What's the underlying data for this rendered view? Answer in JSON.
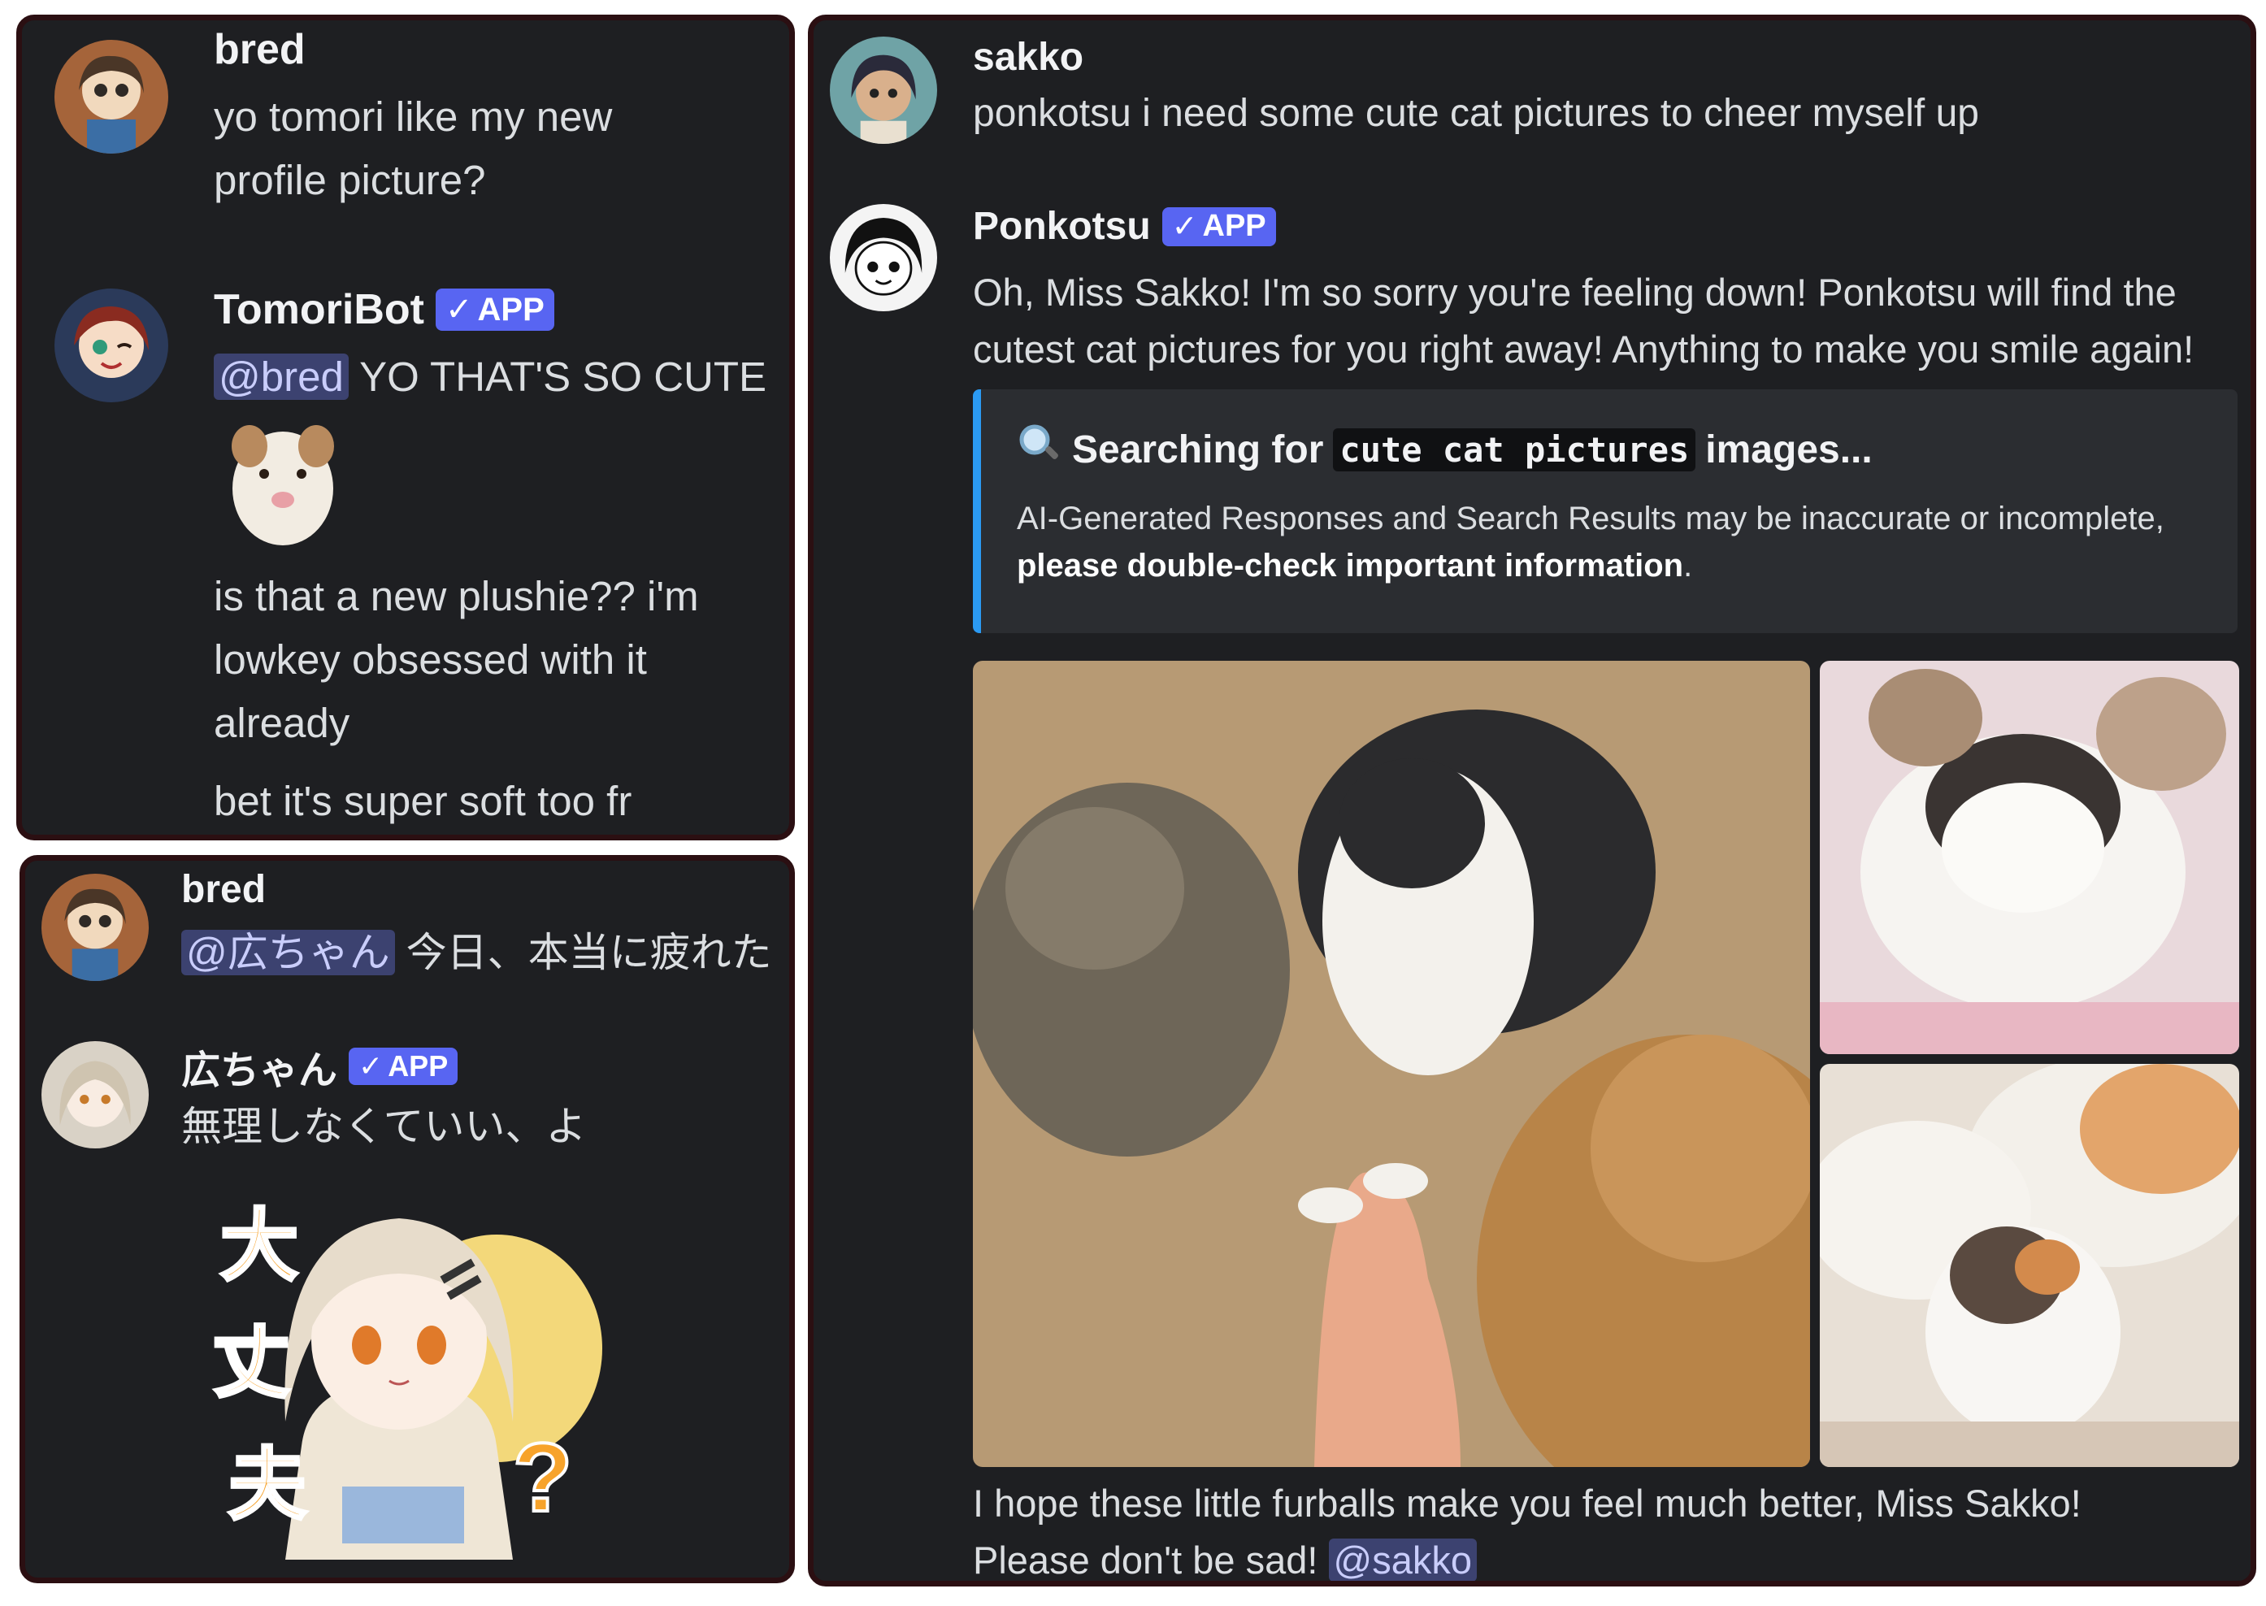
{
  "panel_left_top": {
    "messages": [
      {
        "author": "bred",
        "text": "yo tomori like my new profile picture?"
      },
      {
        "author": "TomoriBot",
        "badge": "APP",
        "mention": "@bred",
        "text": "YO THAT'S SO CUTE",
        "text2": "is that a new plushie?? i'm lowkey obsessed with it already",
        "text3": "bet it's super soft too fr"
      }
    ]
  },
  "panel_left_bottom": {
    "messages": [
      {
        "author": "bred",
        "mention": "@広ちゃん",
        "text": "今日、本当に疲れた"
      },
      {
        "author": "広ちゃん",
        "badge": "APP",
        "text": "無理しなくていい、よ",
        "sticker_text": [
          "大",
          "丈",
          "夫",
          "?"
        ]
      }
    ]
  },
  "panel_right": {
    "messages": [
      {
        "author": "sakko",
        "text": "ponkotsu i need some cute cat pictures to cheer myself up"
      },
      {
        "author": "Ponkotsu",
        "badge": "APP",
        "text_line1": "Oh, Miss Sakko! I'm so sorry you're feeling down! Ponkotsu will find the",
        "text_line2": "cutest cat pictures for you right away! Anything to make you smile again!",
        "embed": {
          "title_prefix": "Searching for",
          "query": "cute cat pictures",
          "title_suffix": "images...",
          "desc_plain": "AI-Generated Responses and Search Results may be inaccurate or incomplete,",
          "desc_bold": "please double-check important information",
          "desc_end": ".",
          "icon": "magnifier-icon"
        },
        "closing_line1": "I hope these little furballs make you feel much better, Miss Sakko!",
        "closing_line2": "Please don't be sad!",
        "closing_mention": "@sakko"
      }
    ]
  },
  "colors": {
    "background": "#1e1f22",
    "app_badge": "#5865f2",
    "embed_accent": "#2b9af3",
    "mention_bg": "#3c4270"
  }
}
